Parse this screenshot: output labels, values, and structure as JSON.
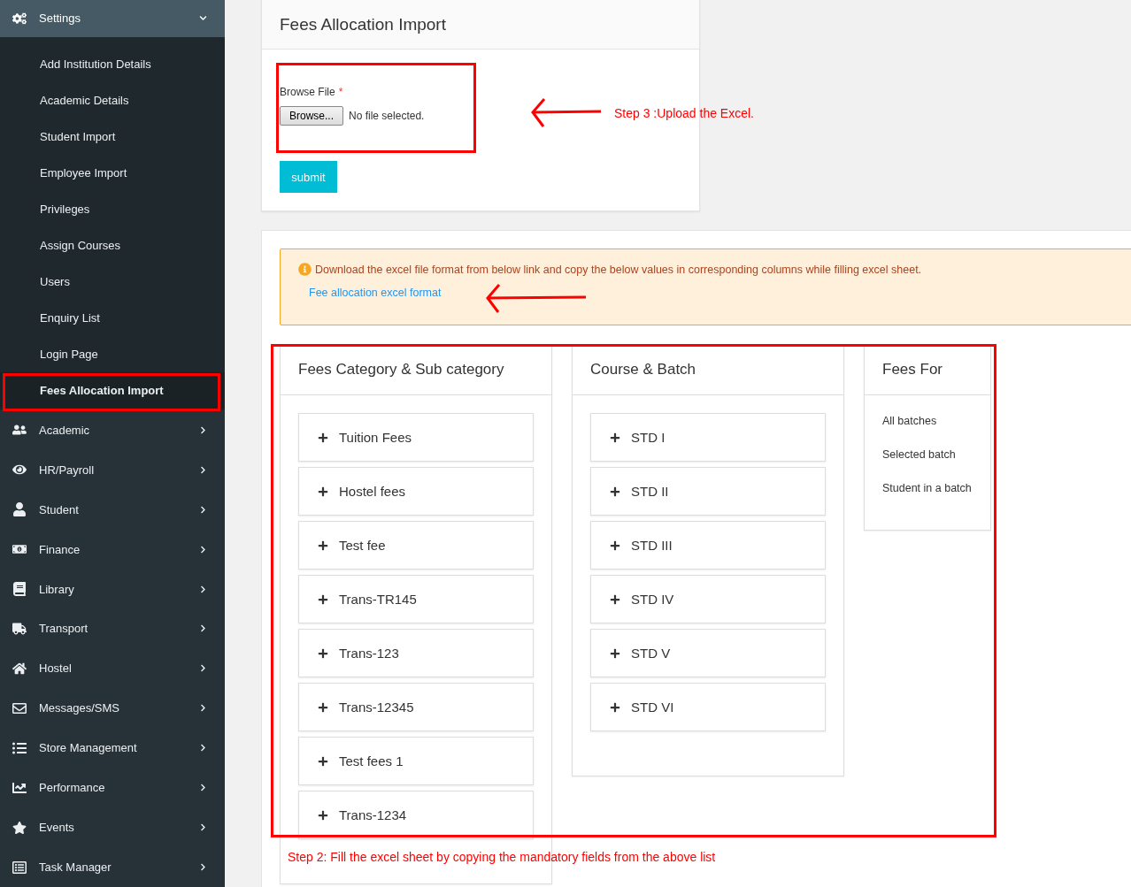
{
  "sidebar": {
    "settings": {
      "label": "Settings",
      "expanded": true,
      "items": [
        {
          "label": "Add Institution Details",
          "selected": false
        },
        {
          "label": "Academic Details",
          "selected": false
        },
        {
          "label": "Student Import",
          "selected": false
        },
        {
          "label": "Employee Import",
          "selected": false
        },
        {
          "label": "Privileges",
          "selected": false
        },
        {
          "label": "Assign Courses",
          "selected": false
        },
        {
          "label": "Users",
          "selected": false
        },
        {
          "label": "Enquiry List",
          "selected": false
        },
        {
          "label": "Login Page",
          "selected": false
        },
        {
          "label": "Fees Allocation Import",
          "selected": true
        }
      ]
    },
    "menu": [
      {
        "label": "Academic"
      },
      {
        "label": "HR/Payroll"
      },
      {
        "label": "Student"
      },
      {
        "label": "Finance"
      },
      {
        "label": "Library"
      },
      {
        "label": "Transport"
      },
      {
        "label": "Hostel"
      },
      {
        "label": "Messages/SMS"
      },
      {
        "label": "Store Management"
      },
      {
        "label": "Performance"
      },
      {
        "label": "Events"
      },
      {
        "label": "Task Manager"
      }
    ]
  },
  "import_card": {
    "title": "Fees Allocation Import",
    "field_label": "Browse File",
    "required_mark": "*",
    "browse_button": "Browse...",
    "file_status": "No file selected.",
    "submit": "submit"
  },
  "alert": {
    "message": "Download the excel file format from below link and copy the below values in corresponding columns while filling excel sheet.",
    "link": "Fee allocation excel format"
  },
  "columns": [
    {
      "title": "Fees Category & Sub category",
      "kind": "expandable",
      "items": [
        "Tuition Fees",
        "Hostel fees",
        "Test fee",
        "Trans-TR145",
        "Trans-123",
        "Trans-12345",
        "Test fees 1",
        "Trans-1234"
      ]
    },
    {
      "title": "Course & Batch",
      "kind": "expandable",
      "items": [
        "STD I",
        "STD II",
        "STD III",
        "STD IV",
        "STD V",
        "STD VI"
      ]
    },
    {
      "title": "Fees For",
      "kind": "plain",
      "items": [
        "All batches",
        "Selected batch",
        "Student in a batch"
      ]
    }
  ],
  "annotations": {
    "step3": "Step 3 :Upload the Excel.",
    "step2": "Step 2: Fill the excel sheet by copying the mandatory fields from the above list"
  }
}
